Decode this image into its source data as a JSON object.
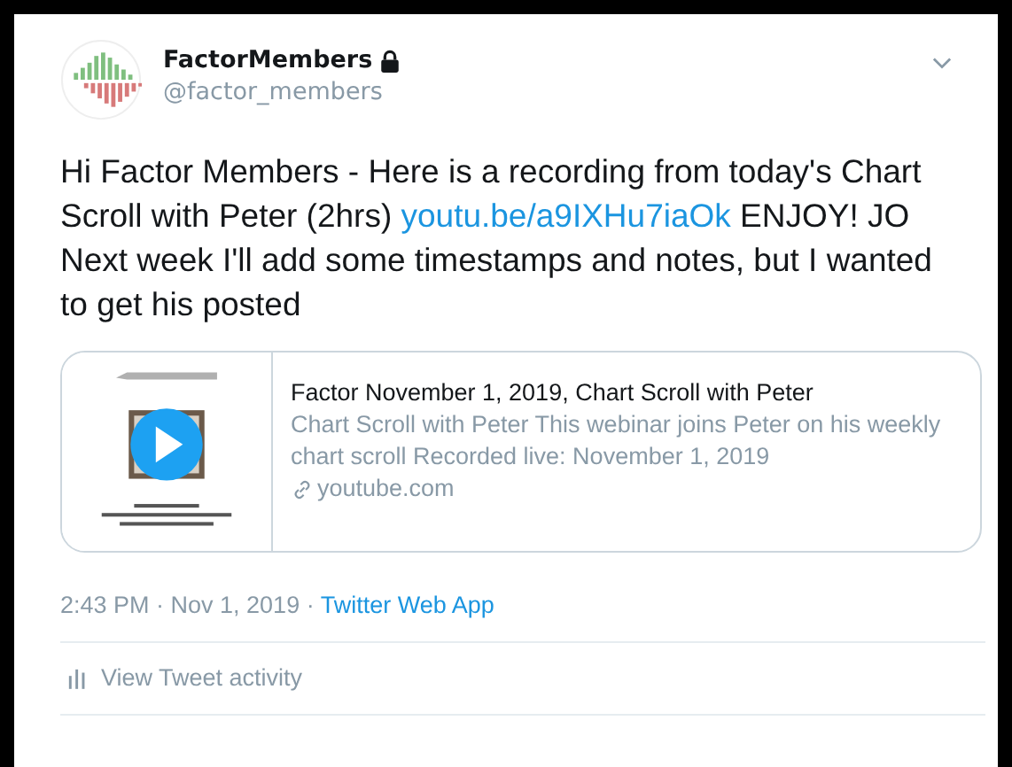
{
  "author": {
    "name": "FactorMembers",
    "handle": "@factor_members",
    "protected": true
  },
  "tweet": {
    "before": "Hi Factor Members - Here is a recording from today's Chart Scroll with Peter (2hrs) ",
    "link": "youtu.be/a9IXHu7iaOk",
    "after": " ENJOY! JO Next week I'll add some timestamps and notes, but I wanted to get his posted"
  },
  "card": {
    "title": "Factor November 1, 2019, Chart Scroll with Peter",
    "description": "Chart Scroll with Peter This webinar joins Peter on his weekly chart scroll Recorded live: November 1, 2019",
    "domain": "youtube.com"
  },
  "meta": {
    "time": "2:43 PM · Nov 1, 2019 · ",
    "source": "Twitter Web App"
  },
  "activity": {
    "label": "View Tweet activity"
  }
}
